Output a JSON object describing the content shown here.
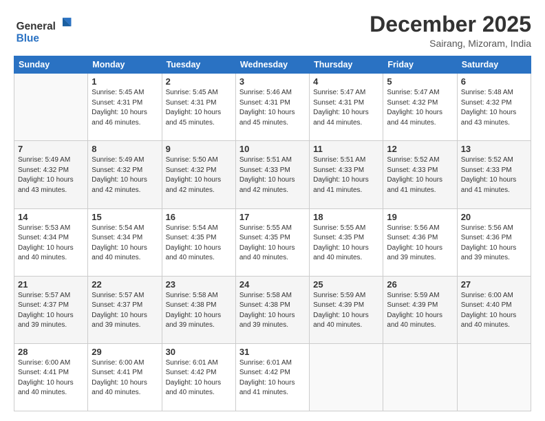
{
  "header": {
    "logo_general": "General",
    "logo_blue": "Blue",
    "month_title": "December 2025",
    "location": "Sairang, Mizoram, India"
  },
  "weekdays": [
    "Sunday",
    "Monday",
    "Tuesday",
    "Wednesday",
    "Thursday",
    "Friday",
    "Saturday"
  ],
  "weeks": [
    [
      {
        "day": "",
        "sunrise": "",
        "sunset": "",
        "daylight": ""
      },
      {
        "day": "1",
        "sunrise": "5:45 AM",
        "sunset": "4:31 PM",
        "daylight": "10 hours and 46 minutes."
      },
      {
        "day": "2",
        "sunrise": "5:45 AM",
        "sunset": "4:31 PM",
        "daylight": "10 hours and 45 minutes."
      },
      {
        "day": "3",
        "sunrise": "5:46 AM",
        "sunset": "4:31 PM",
        "daylight": "10 hours and 45 minutes."
      },
      {
        "day": "4",
        "sunrise": "5:47 AM",
        "sunset": "4:31 PM",
        "daylight": "10 hours and 44 minutes."
      },
      {
        "day": "5",
        "sunrise": "5:47 AM",
        "sunset": "4:32 PM",
        "daylight": "10 hours and 44 minutes."
      },
      {
        "day": "6",
        "sunrise": "5:48 AM",
        "sunset": "4:32 PM",
        "daylight": "10 hours and 43 minutes."
      }
    ],
    [
      {
        "day": "7",
        "sunrise": "5:49 AM",
        "sunset": "4:32 PM",
        "daylight": "10 hours and 43 minutes."
      },
      {
        "day": "8",
        "sunrise": "5:49 AM",
        "sunset": "4:32 PM",
        "daylight": "10 hours and 42 minutes."
      },
      {
        "day": "9",
        "sunrise": "5:50 AM",
        "sunset": "4:32 PM",
        "daylight": "10 hours and 42 minutes."
      },
      {
        "day": "10",
        "sunrise": "5:51 AM",
        "sunset": "4:33 PM",
        "daylight": "10 hours and 42 minutes."
      },
      {
        "day": "11",
        "sunrise": "5:51 AM",
        "sunset": "4:33 PM",
        "daylight": "10 hours and 41 minutes."
      },
      {
        "day": "12",
        "sunrise": "5:52 AM",
        "sunset": "4:33 PM",
        "daylight": "10 hours and 41 minutes."
      },
      {
        "day": "13",
        "sunrise": "5:52 AM",
        "sunset": "4:33 PM",
        "daylight": "10 hours and 41 minutes."
      }
    ],
    [
      {
        "day": "14",
        "sunrise": "5:53 AM",
        "sunset": "4:34 PM",
        "daylight": "10 hours and 40 minutes."
      },
      {
        "day": "15",
        "sunrise": "5:54 AM",
        "sunset": "4:34 PM",
        "daylight": "10 hours and 40 minutes."
      },
      {
        "day": "16",
        "sunrise": "5:54 AM",
        "sunset": "4:35 PM",
        "daylight": "10 hours and 40 minutes."
      },
      {
        "day": "17",
        "sunrise": "5:55 AM",
        "sunset": "4:35 PM",
        "daylight": "10 hours and 40 minutes."
      },
      {
        "day": "18",
        "sunrise": "5:55 AM",
        "sunset": "4:35 PM",
        "daylight": "10 hours and 40 minutes."
      },
      {
        "day": "19",
        "sunrise": "5:56 AM",
        "sunset": "4:36 PM",
        "daylight": "10 hours and 39 minutes."
      },
      {
        "day": "20",
        "sunrise": "5:56 AM",
        "sunset": "4:36 PM",
        "daylight": "10 hours and 39 minutes."
      }
    ],
    [
      {
        "day": "21",
        "sunrise": "5:57 AM",
        "sunset": "4:37 PM",
        "daylight": "10 hours and 39 minutes."
      },
      {
        "day": "22",
        "sunrise": "5:57 AM",
        "sunset": "4:37 PM",
        "daylight": "10 hours and 39 minutes."
      },
      {
        "day": "23",
        "sunrise": "5:58 AM",
        "sunset": "4:38 PM",
        "daylight": "10 hours and 39 minutes."
      },
      {
        "day": "24",
        "sunrise": "5:58 AM",
        "sunset": "4:38 PM",
        "daylight": "10 hours and 39 minutes."
      },
      {
        "day": "25",
        "sunrise": "5:59 AM",
        "sunset": "4:39 PM",
        "daylight": "10 hours and 40 minutes."
      },
      {
        "day": "26",
        "sunrise": "5:59 AM",
        "sunset": "4:39 PM",
        "daylight": "10 hours and 40 minutes."
      },
      {
        "day": "27",
        "sunrise": "6:00 AM",
        "sunset": "4:40 PM",
        "daylight": "10 hours and 40 minutes."
      }
    ],
    [
      {
        "day": "28",
        "sunrise": "6:00 AM",
        "sunset": "4:41 PM",
        "daylight": "10 hours and 40 minutes."
      },
      {
        "day": "29",
        "sunrise": "6:00 AM",
        "sunset": "4:41 PM",
        "daylight": "10 hours and 40 minutes."
      },
      {
        "day": "30",
        "sunrise": "6:01 AM",
        "sunset": "4:42 PM",
        "daylight": "10 hours and 40 minutes."
      },
      {
        "day": "31",
        "sunrise": "6:01 AM",
        "sunset": "4:42 PM",
        "daylight": "10 hours and 41 minutes."
      },
      {
        "day": "",
        "sunrise": "",
        "sunset": "",
        "daylight": ""
      },
      {
        "day": "",
        "sunrise": "",
        "sunset": "",
        "daylight": ""
      },
      {
        "day": "",
        "sunrise": "",
        "sunset": "",
        "daylight": ""
      }
    ]
  ],
  "labels": {
    "sunrise_prefix": "Sunrise: ",
    "sunset_prefix": "Sunset: ",
    "daylight_prefix": "Daylight: "
  }
}
